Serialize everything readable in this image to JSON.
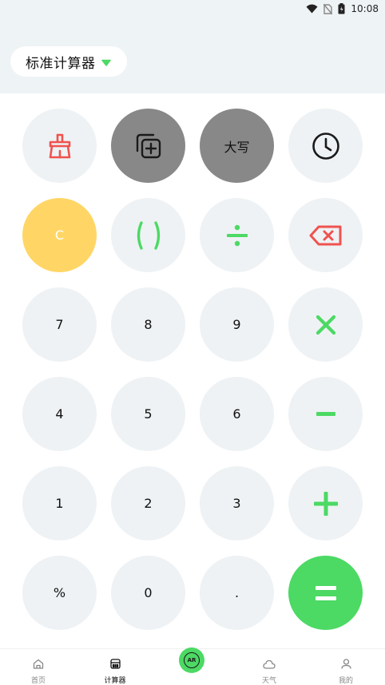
{
  "status_bar": {
    "time": "10:08"
  },
  "header": {
    "mode_label": "标准计算器"
  },
  "keys": {
    "copy": "",
    "caps": "大写",
    "clear": "C",
    "paren": "( )",
    "seven": "7",
    "eight": "8",
    "nine": "9",
    "four": "4",
    "five": "5",
    "six": "6",
    "one": "1",
    "two": "2",
    "three": "3",
    "percent": "%",
    "zero": "0",
    "dot": "."
  },
  "nav": {
    "home": "首页",
    "calculator": "计算器",
    "ar": "AR",
    "weather": "天气",
    "mine": "我的"
  },
  "colors": {
    "accent_green": "#4cd964",
    "clear_yellow": "#ffd666",
    "delete_red": "#f0524f",
    "dark_key": "#888888"
  }
}
